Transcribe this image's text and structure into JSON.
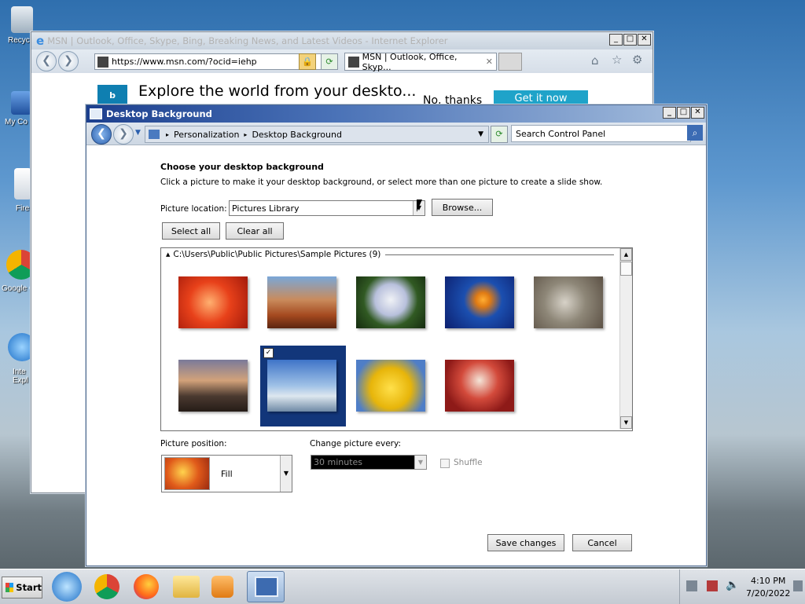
{
  "desktop": {
    "icons": [
      {
        "label": "Recyc",
        "name": "recycle-bin"
      },
      {
        "label": "My Co",
        "name": "my-computer"
      },
      {
        "label": "Fire",
        "name": "firefox"
      },
      {
        "label": "Google C",
        "name": "google-chrome"
      },
      {
        "label": "Inte Expl",
        "name": "internet-explorer"
      }
    ]
  },
  "ie": {
    "title": "MSN | Outlook, Office, Skype, Bing, Breaking News, and Latest Videos - Internet Explorer",
    "address": "https://www.msn.com/?ocid=iehp",
    "tab_title": "MSN | Outlook, Office, Skyp...",
    "banner_text": "Explore the world from your deskto...",
    "banner_no": "No, thanks",
    "banner_yes": "Get it now"
  },
  "dialog": {
    "title": "Desktop Background",
    "breadcrumb": [
      "Personalization",
      "Desktop Background"
    ],
    "search_placeholder": "Search Control Panel",
    "heading": "Choose your desktop background",
    "instruction": "Click a picture to make it your desktop background, or select more than one picture to create a slide show.",
    "location_label": "Picture location:",
    "location_value": "Pictures Library",
    "browse_label": "Browse...",
    "select_all_label": "Select all",
    "clear_all_label": "Clear all",
    "group_header": "C:\\Users\\Public\\Public Pictures\\Sample Pictures (9)",
    "pictures": [
      {
        "name": "chrysanthemum",
        "selected": false
      },
      {
        "name": "desert",
        "selected": false
      },
      {
        "name": "hydrangeas",
        "selected": false
      },
      {
        "name": "jellyfish",
        "selected": false
      },
      {
        "name": "koala",
        "selected": false
      },
      {
        "name": "lighthouse",
        "selected": false
      },
      {
        "name": "penguins",
        "selected": true
      },
      {
        "name": "tulips",
        "selected": false
      },
      {
        "name": "santa",
        "selected": false
      }
    ],
    "position_label": "Picture position:",
    "position_value": "Fill",
    "change_label": "Change picture every:",
    "change_value": "30 minutes",
    "shuffle_label": "Shuffle",
    "save_label": "Save changes",
    "cancel_label": "Cancel"
  },
  "taskbar": {
    "start_label": "Start",
    "time": "4:10 PM",
    "date": "7/20/2022"
  }
}
